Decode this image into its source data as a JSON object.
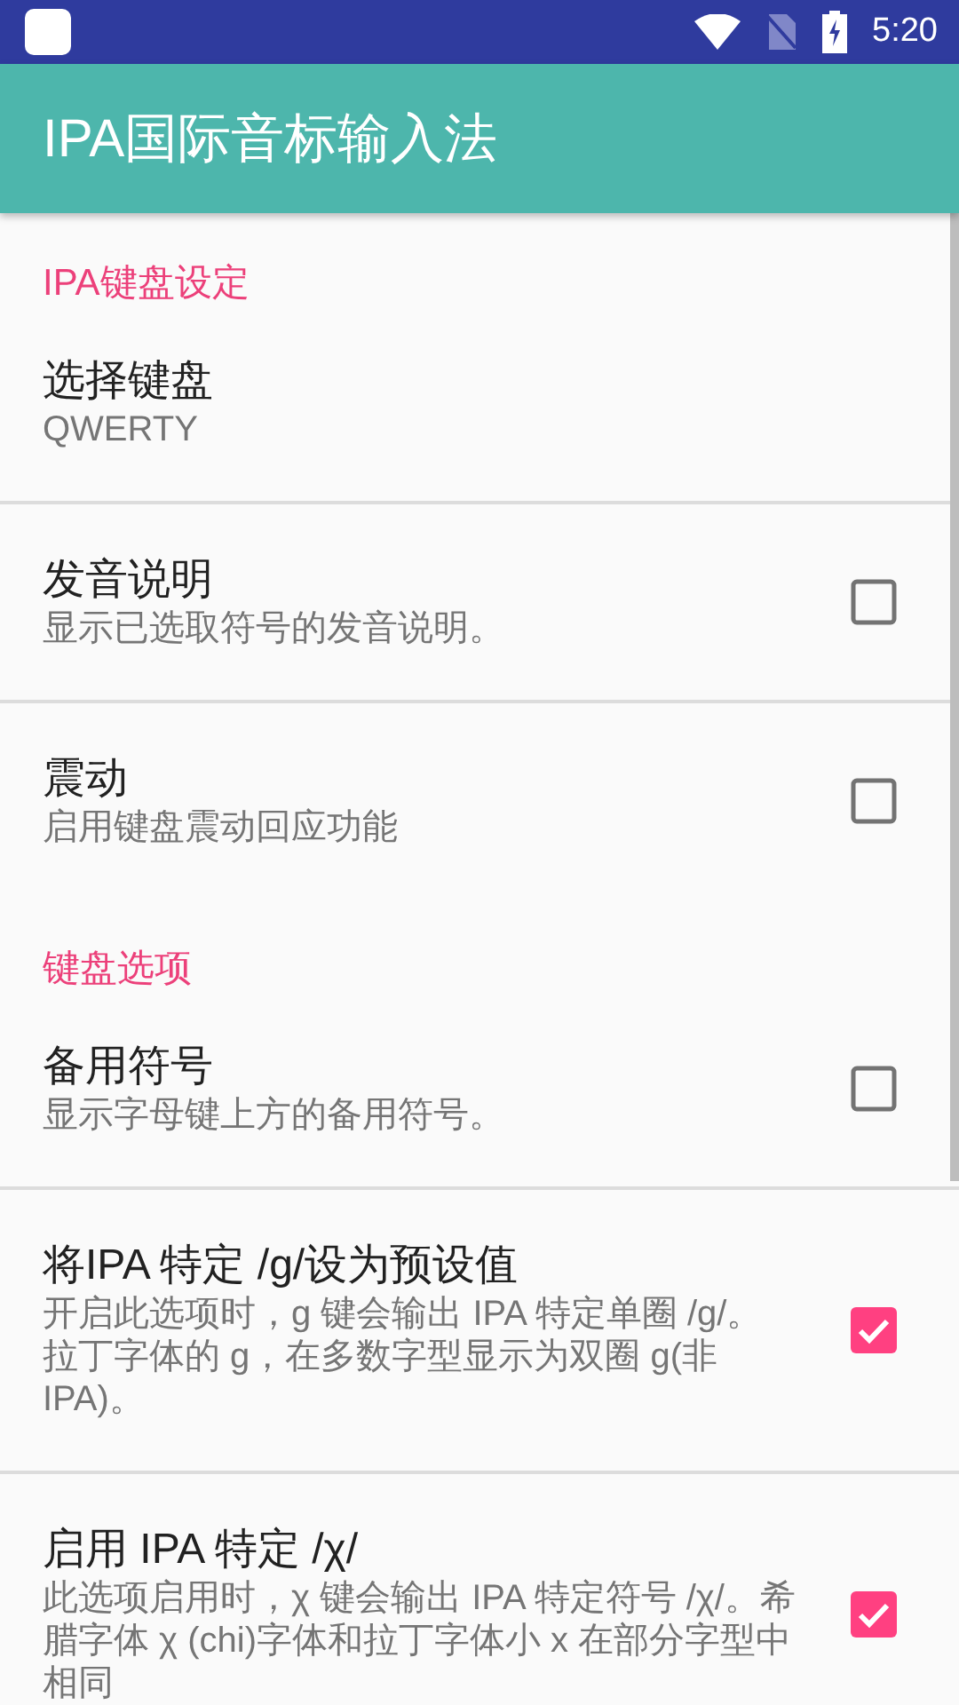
{
  "status_bar": {
    "time": "5:20"
  },
  "app_bar": {
    "title": "IPA国际音标输入法"
  },
  "preferences": [
    {
      "kind": "category",
      "title": "IPA键盘设定"
    },
    {
      "kind": "item",
      "title": "选择键盘",
      "summary": "QWERTY"
    },
    {
      "kind": "checkbox",
      "title": "发音说明",
      "summary": "显示已选取符号的发音说明。",
      "checked": false
    },
    {
      "kind": "checkbox",
      "title": "震动",
      "summary": "启用键盘震动回应功能",
      "checked": false
    },
    {
      "kind": "category",
      "title": "键盘选项"
    },
    {
      "kind": "checkbox",
      "title": "备用符号",
      "summary": "显示字母键上方的备用符号。",
      "checked": false
    },
    {
      "kind": "checkbox",
      "title": "将IPA 特定 /g/设为预设值",
      "summary": "开启此选项时，g 键会输出 IPA 特定单圈 /g/。拉丁字体的 g，在多数字型显示为双圈 g(非IPA)。",
      "checked": true
    },
    {
      "kind": "checkbox",
      "title": "启用 IPA 特定 /χ/",
      "summary": "此选项启用时，χ 键会输出 IPA 特定符号 /χ/。希腊字体 χ (chi)字体和拉丁字体小 x 在部分字型中相同",
      "checked": true
    }
  ]
}
